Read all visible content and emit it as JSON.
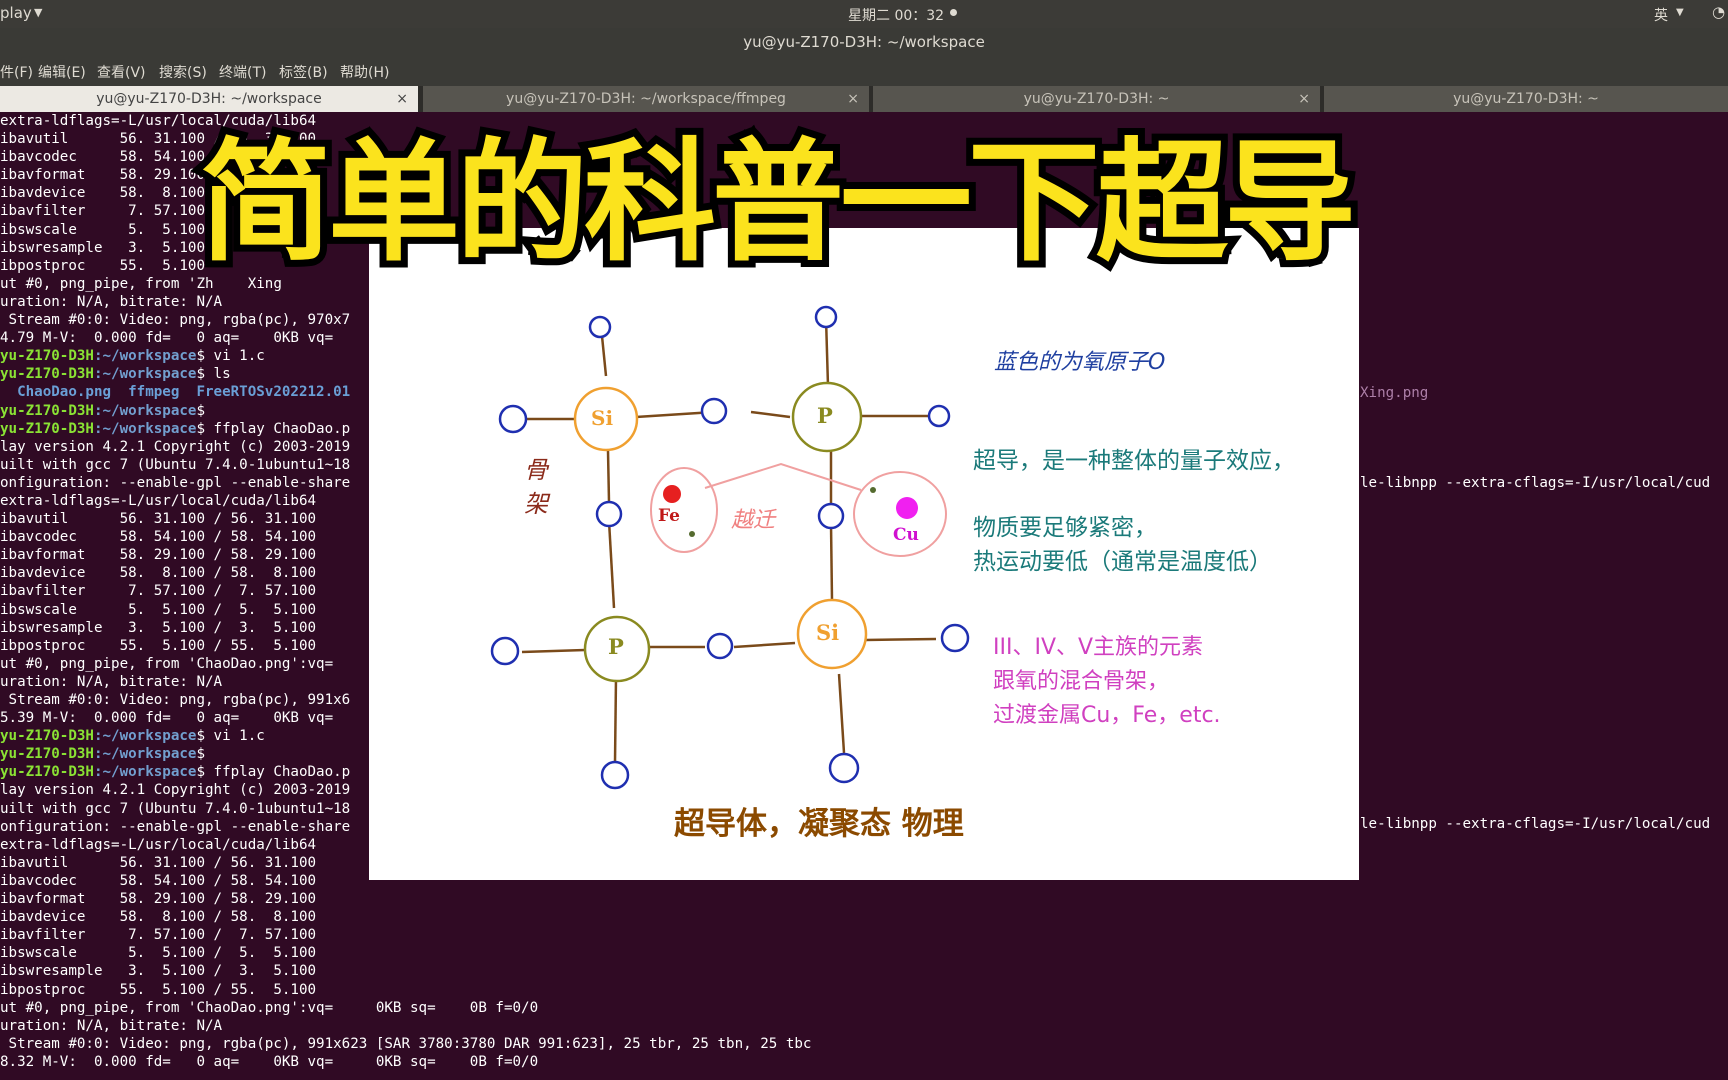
{
  "topbar": {
    "app_menu": "play",
    "clock": "星期二 00：32",
    "input_method": "英"
  },
  "window": {
    "title": "yu@yu-Z170-D3H: ~/workspace"
  },
  "menu": [
    "件(F)",
    "编辑(E)",
    "查看(V)",
    "搜索(S)",
    "终端(T)",
    "标签(B)",
    "帮助(H)"
  ],
  "tabs": [
    {
      "label": "yu@yu-Z170-D3H: ~/workspace",
      "close": "×"
    },
    {
      "label": "yu@yu-Z170-D3H: ~/workspace/ffmpeg",
      "close": "×"
    },
    {
      "label": "yu@yu-Z170-D3H: ~",
      "close": "×"
    },
    {
      "label": "yu@yu-Z170-D3H: ~"
    }
  ],
  "terminal": {
    "lines": [
      "extra-ldflags=-L/usr/local/cuda/lib64",
      "ibavutil      56. 31.100 / 56. 31.100",
      "ibavcodec     58. 54.100 /",
      "ibavformat    58. 29.100",
      "ibavdevice    58.  8.100",
      "ibavfilter     7. 57.100",
      "ibswscale      5.  5.100",
      "ibswresample   3.  5.100",
      "ibpostproc    55.  5.100",
      "ut #0, png_pipe, from 'Zh    Xing",
      "uration: N/A, bitrate: N/A",
      " Stream #0:0: Video: png, rgba(pc), 970x7",
      "4.79 M-V:  0.000 fd=   0 aq=    0KB vq=",
      {
        "user": "yu-Z170-D3H",
        "path": ":~/workspace",
        "cmd": "$ vi 1.c"
      },
      {
        "user": "yu-Z170-D3H",
        "path": ":~/workspace",
        "cmd": "$ ls"
      },
      {
        "files": "  ChaoDao.png  ffmpeg  FreeRTOSv202212.01"
      },
      {
        "user": "yu-Z170-D3H",
        "path": ":~/workspace",
        "cmd": "$"
      },
      {
        "user": "yu-Z170-D3H",
        "path": ":~/workspace",
        "cmd": "$ ffplay ChaoDao.p"
      },
      "lay version 4.2.1 Copyright (c) 2003-2019",
      "uilt with gcc 7 (Ubuntu 7.4.0-1ubuntu1~18",
      "onfiguration: --enable-gpl --enable-share",
      "extra-ldflags=-L/usr/local/cuda/lib64",
      "ibavutil      56. 31.100 / 56. 31.100",
      "ibavcodec     58. 54.100 / 58. 54.100",
      "ibavformat    58. 29.100 / 58. 29.100",
      "ibavdevice    58.  8.100 / 58.  8.100",
      "ibavfilter     7. 57.100 /  7. 57.100",
      "ibswscale      5.  5.100 /  5.  5.100",
      "ibswresample   3.  5.100 /  3.  5.100",
      "ibpostproc    55.  5.100 / 55.  5.100",
      "ut #0, png_pipe, from 'ChaoDao.png':vq=",
      "uration: N/A, bitrate: N/A",
      " Stream #0:0: Video: png, rgba(pc), 991x6",
      "5.39 M-V:  0.000 fd=   0 aq=    0KB vq=",
      {
        "user": "yu-Z170-D3H",
        "path": ":~/workspace",
        "cmd": "$ vi 1.c"
      },
      {
        "user": "yu-Z170-D3H",
        "path": ":~/workspace",
        "cmd": "$"
      },
      {
        "user": "yu-Z170-D3H",
        "path": ":~/workspace",
        "cmd": "$ ffplay ChaoDao.p"
      },
      "lay version 4.2.1 Copyright (c) 2003-2019",
      "uilt with gcc 7 (Ubuntu 7.4.0-1ubuntu1~18",
      "onfiguration: --enable-gpl --enable-share",
      "extra-ldflags=-L/usr/local/cuda/lib64",
      "ibavutil      56. 31.100 / 56. 31.100",
      "ibavcodec     58. 54.100 / 58. 54.100",
      "ibavformat    58. 29.100 / 58. 29.100",
      "ibavdevice    58.  8.100 / 58.  8.100",
      "ibavfilter     7. 57.100 /  7. 57.100",
      "ibswscale      5.  5.100 /  5.  5.100",
      "ibswresample   3.  5.100 /  3.  5.100",
      "ibpostproc    55.  5.100 / 55.  5.100",
      "ut #0, png_pipe, from 'ChaoDao.png':vq=     0KB sq=    0B f=0/0",
      "uration: N/A, bitrate: N/A",
      " Stream #0:0: Video: png, rgba(pc), 991x623 [SAR 3780:3780 DAR 991:623], 25 tbr, 25 tbn, 25 tbc",
      "8.32 M-V:  0.000 fd=   0 aq=    0KB vq=     0KB sq=    0B f=0/0"
    ],
    "right_file": "Xing.png",
    "right_line1": "le-libnpp --extra-cflags=-I/usr/local/cud",
    "right_line2": "le-libnpp --extra-cflags=-I/usr/local/cud"
  },
  "headline": "简单的科普一下超导",
  "diagram": {
    "caption_blue": "蓝色的为氧原子O",
    "side_label": [
      "骨",
      "架"
    ],
    "atoms": {
      "si": "Si",
      "p": "P",
      "fe": "Fe",
      "cu": "Cu"
    },
    "hop_label": "越迁",
    "text1": "超导，是一种整体的量子效应，",
    "text2": "物质要足够紧密，",
    "text3": "热运动要低（通常是温度低）",
    "text4": "III、IV、V主族的元素",
    "text5": "跟氧的混合骨架，",
    "text6": "过渡金属Cu，Fe，etc.",
    "bottom": "超导体，凝聚态 物理"
  },
  "colors": {
    "terminal_bg": "#300a24",
    "prompt_user": "#8ae234",
    "prompt_path": "#729fcf",
    "headline": "#fbe31d",
    "oxygen": "#1f2fb0",
    "si": "#f0a030",
    "p": "#8a8a20",
    "bond": "#7a4a1a",
    "teal_text": "#1b7a7a",
    "magenta_text": "#d040c0",
    "brown_text": "#8b4a00"
  }
}
